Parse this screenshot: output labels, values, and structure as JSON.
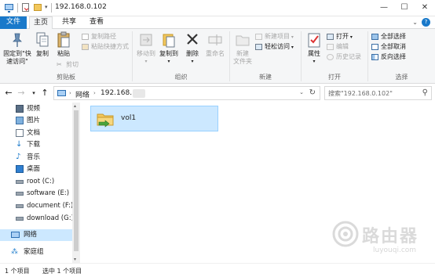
{
  "window": {
    "title": "192.168.0.102",
    "minimize": "—",
    "maximize": "☐",
    "close": "✕"
  },
  "tabs": [
    {
      "label": "文件",
      "active": false
    },
    {
      "label": "主页",
      "active": true
    },
    {
      "label": "共享",
      "active": false
    },
    {
      "label": "查看",
      "active": false
    }
  ],
  "ribbon": {
    "clipboard": {
      "label": "剪贴板",
      "pin_label": "固定到\"快\n速访问\"",
      "copy_label": "复制",
      "paste_label": "粘贴",
      "copy_path": "复制路径",
      "paste_shortcut": "粘贴快捷方式",
      "cut": "剪切"
    },
    "organize": {
      "label": "组织",
      "move_to": "移动到",
      "copy_to": "复制到",
      "delete": "删除",
      "rename": "重命名"
    },
    "new": {
      "label": "新建",
      "new_folder": "新建\n文件夹",
      "new_item": "新建项目",
      "easy_access": "轻松访问"
    },
    "open": {
      "label": "打开",
      "properties": "属性",
      "open": "打开",
      "edit": "编辑",
      "history": "历史记录"
    },
    "select": {
      "label": "选择",
      "select_all": "全部选择",
      "select_none": "全部取消",
      "invert": "反向选择"
    }
  },
  "address": {
    "crumbs": [
      "网络",
      "192.168..."
    ],
    "search_placeholder": "搜索\"192.168.0.102\""
  },
  "nav_pane": {
    "items": [
      {
        "label": "视频",
        "icon": "video-icon"
      },
      {
        "label": "图片",
        "icon": "pictures-icon"
      },
      {
        "label": "文档",
        "icon": "documents-icon"
      },
      {
        "label": "下载",
        "icon": "downloads-icon"
      },
      {
        "label": "音乐",
        "icon": "music-icon"
      },
      {
        "label": "桌面",
        "icon": "desktop-icon"
      },
      {
        "label": "root (C:)",
        "icon": "drive-icon"
      },
      {
        "label": "software (E:)",
        "icon": "drive-icon"
      },
      {
        "label": "document (F:)",
        "icon": "drive-icon"
      },
      {
        "label": "download (G:)",
        "icon": "drive-icon"
      },
      {
        "label": "网络",
        "icon": "network-icon",
        "selected": true
      },
      {
        "label": "家庭组",
        "icon": "homegroup-icon"
      }
    ]
  },
  "content": {
    "items": [
      {
        "name": "vol1",
        "icon": "network-share-icon",
        "selected": true
      }
    ]
  },
  "status": {
    "count": "1 个项目",
    "selected": "选中 1 个项目"
  },
  "watermark": {
    "title": "路由器",
    "url": "luyouqi.com"
  }
}
